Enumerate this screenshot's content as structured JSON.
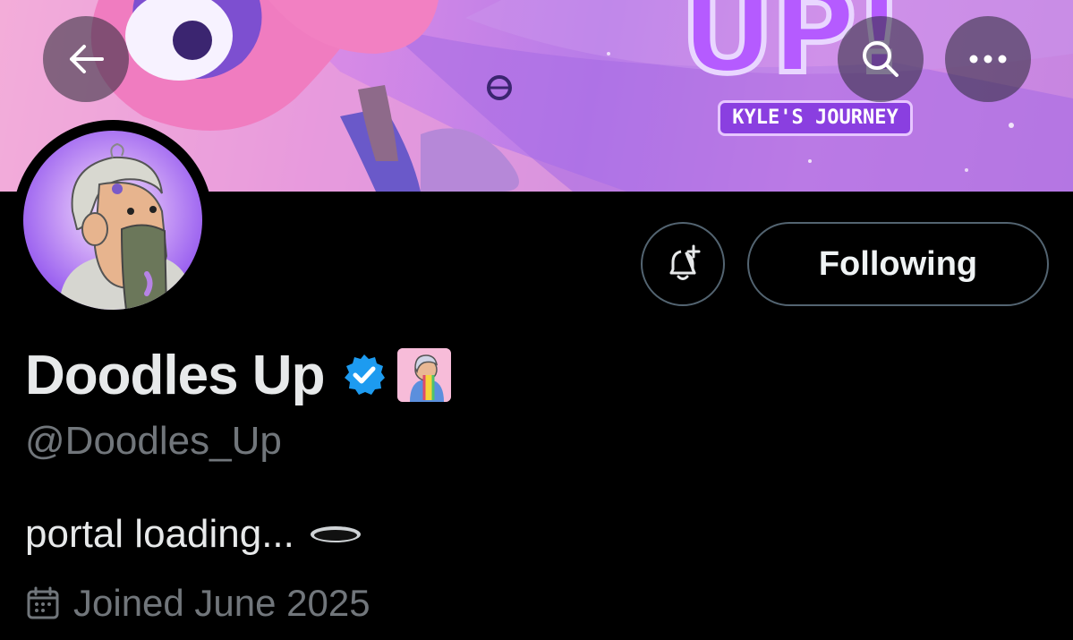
{
  "header": {
    "back_icon": "arrow-left-icon",
    "search_icon": "search-icon",
    "more_icon": "more-horizontal-icon"
  },
  "banner": {
    "logo_text": "UP!",
    "subtitle": "KYLE'S JOURNEY"
  },
  "profile": {
    "display_name": "Doodles Up",
    "verified": true,
    "handle": "@Doodles_Up",
    "bio": "portal loading...",
    "joined": "Joined June 2025"
  },
  "actions": {
    "notify_icon": "bell-plus-icon",
    "following_label": "Following"
  },
  "colors": {
    "background": "#000000",
    "primary_text": "#e7e9ea",
    "secondary_text": "#71767b",
    "button_border": "#536471",
    "verified_blue": "#1d9bf0"
  }
}
